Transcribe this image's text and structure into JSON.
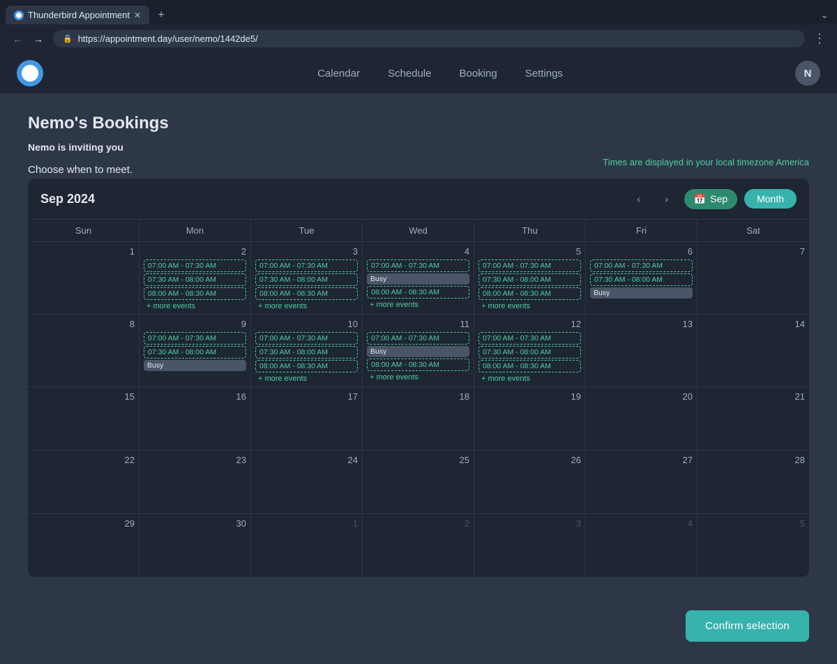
{
  "browser": {
    "tab_label": "Thunderbird Appointment",
    "url": "https://appointment.day/user/nemo/1442de5/",
    "new_tab_label": "+",
    "minimize_label": "⌄"
  },
  "nav": {
    "calendar": "Calendar",
    "schedule": "Schedule",
    "booking": "Booking",
    "settings": "Settings",
    "avatar_initial": "N"
  },
  "page": {
    "title": "Nemo's Bookings",
    "invite_text": "Nemo is inviting you",
    "choose_text": "Choose when to meet.",
    "timezone_text": "Times are displayed in your local timezone America"
  },
  "calendar": {
    "title": "Sep 2024",
    "sep_label": "Sep",
    "month_label": "Month",
    "day_headers": [
      "Sun",
      "Mon",
      "Tue",
      "Wed",
      "Thu",
      "Fri",
      "Sat"
    ],
    "weeks": [
      [
        {
          "number": "1",
          "other": false,
          "events": []
        },
        {
          "number": "2",
          "other": false,
          "events": [
            {
              "type": "available",
              "label": "07:00 AM - 07:30 AM"
            },
            {
              "type": "available",
              "label": "07:30 AM - 08:00 AM"
            },
            {
              "type": "available",
              "label": "08:00 AM - 08:30 AM"
            },
            {
              "type": "more",
              "label": "+ more events"
            }
          ]
        },
        {
          "number": "3",
          "other": false,
          "events": [
            {
              "type": "available",
              "label": "07:00 AM - 07:30 AM"
            },
            {
              "type": "available",
              "label": "07:30 AM - 08:00 AM"
            },
            {
              "type": "available",
              "label": "08:00 AM - 08:30 AM"
            },
            {
              "type": "more",
              "label": "+ more events"
            }
          ]
        },
        {
          "number": "4",
          "other": false,
          "events": [
            {
              "type": "available",
              "label": "07:00 AM - 07:30 AM"
            },
            {
              "type": "busy",
              "label": "Busy"
            },
            {
              "type": "available",
              "label": "08:00 AM - 08:30 AM"
            },
            {
              "type": "more",
              "label": "+ more events"
            }
          ]
        },
        {
          "number": "5",
          "other": false,
          "events": [
            {
              "type": "available",
              "label": "07:00 AM - 07:30 AM"
            },
            {
              "type": "available",
              "label": "07:30 AM - 08:00 AM"
            },
            {
              "type": "available",
              "label": "08:00 AM - 08:30 AM"
            },
            {
              "type": "more",
              "label": "+ more events"
            }
          ]
        },
        {
          "number": "6",
          "other": false,
          "events": [
            {
              "type": "available",
              "label": "07:00 AM - 07:30 AM"
            },
            {
              "type": "available",
              "label": "07:30 AM - 08:00 AM"
            },
            {
              "type": "busy",
              "label": "Busy"
            }
          ]
        },
        {
          "number": "7",
          "other": false,
          "events": []
        }
      ],
      [
        {
          "number": "8",
          "other": false,
          "events": []
        },
        {
          "number": "9",
          "other": false,
          "events": [
            {
              "type": "available",
              "label": "07:00 AM - 07:30 AM"
            },
            {
              "type": "available",
              "label": "07:30 AM - 08:00 AM"
            },
            {
              "type": "busy",
              "label": "Busy"
            }
          ]
        },
        {
          "number": "10",
          "other": false,
          "events": [
            {
              "type": "available",
              "label": "07:00 AM - 07:30 AM"
            },
            {
              "type": "available",
              "label": "07:30 AM - 08:00 AM"
            },
            {
              "type": "available",
              "label": "08:00 AM - 08:30 AM"
            },
            {
              "type": "more",
              "label": "+ more events"
            }
          ]
        },
        {
          "number": "11",
          "other": false,
          "events": [
            {
              "type": "available",
              "label": "07:00 AM - 07:30 AM"
            },
            {
              "type": "busy",
              "label": "Busy"
            },
            {
              "type": "available",
              "label": "08:00 AM - 08:30 AM"
            },
            {
              "type": "more",
              "label": "+ more events"
            }
          ]
        },
        {
          "number": "12",
          "other": false,
          "events": [
            {
              "type": "available",
              "label": "07:00 AM - 07:30 AM"
            },
            {
              "type": "available",
              "label": "07:30 AM - 08:00 AM"
            },
            {
              "type": "available",
              "label": "08:00 AM - 08:30 AM"
            },
            {
              "type": "more",
              "label": "+ more events"
            }
          ]
        },
        {
          "number": "13",
          "other": false,
          "events": []
        },
        {
          "number": "14",
          "other": false,
          "events": []
        }
      ],
      [
        {
          "number": "15",
          "other": false,
          "events": []
        },
        {
          "number": "16",
          "other": false,
          "events": []
        },
        {
          "number": "17",
          "other": false,
          "events": []
        },
        {
          "number": "18",
          "other": false,
          "events": []
        },
        {
          "number": "19",
          "other": false,
          "events": []
        },
        {
          "number": "20",
          "other": false,
          "events": []
        },
        {
          "number": "21",
          "other": false,
          "events": []
        }
      ],
      [
        {
          "number": "22",
          "other": false,
          "events": []
        },
        {
          "number": "23",
          "other": false,
          "events": []
        },
        {
          "number": "24",
          "other": false,
          "events": []
        },
        {
          "number": "25",
          "other": false,
          "events": []
        },
        {
          "number": "26",
          "other": false,
          "events": []
        },
        {
          "number": "27",
          "other": false,
          "events": []
        },
        {
          "number": "28",
          "other": false,
          "events": []
        }
      ],
      [
        {
          "number": "29",
          "other": false,
          "events": []
        },
        {
          "number": "30",
          "other": false,
          "events": []
        },
        {
          "number": "1",
          "other": true,
          "events": []
        },
        {
          "number": "2",
          "other": true,
          "events": []
        },
        {
          "number": "3",
          "other": true,
          "events": []
        },
        {
          "number": "4",
          "other": true,
          "events": []
        },
        {
          "number": "5",
          "other": true,
          "events": []
        }
      ]
    ]
  },
  "footer": {
    "confirm_label": "Confirm selection"
  }
}
